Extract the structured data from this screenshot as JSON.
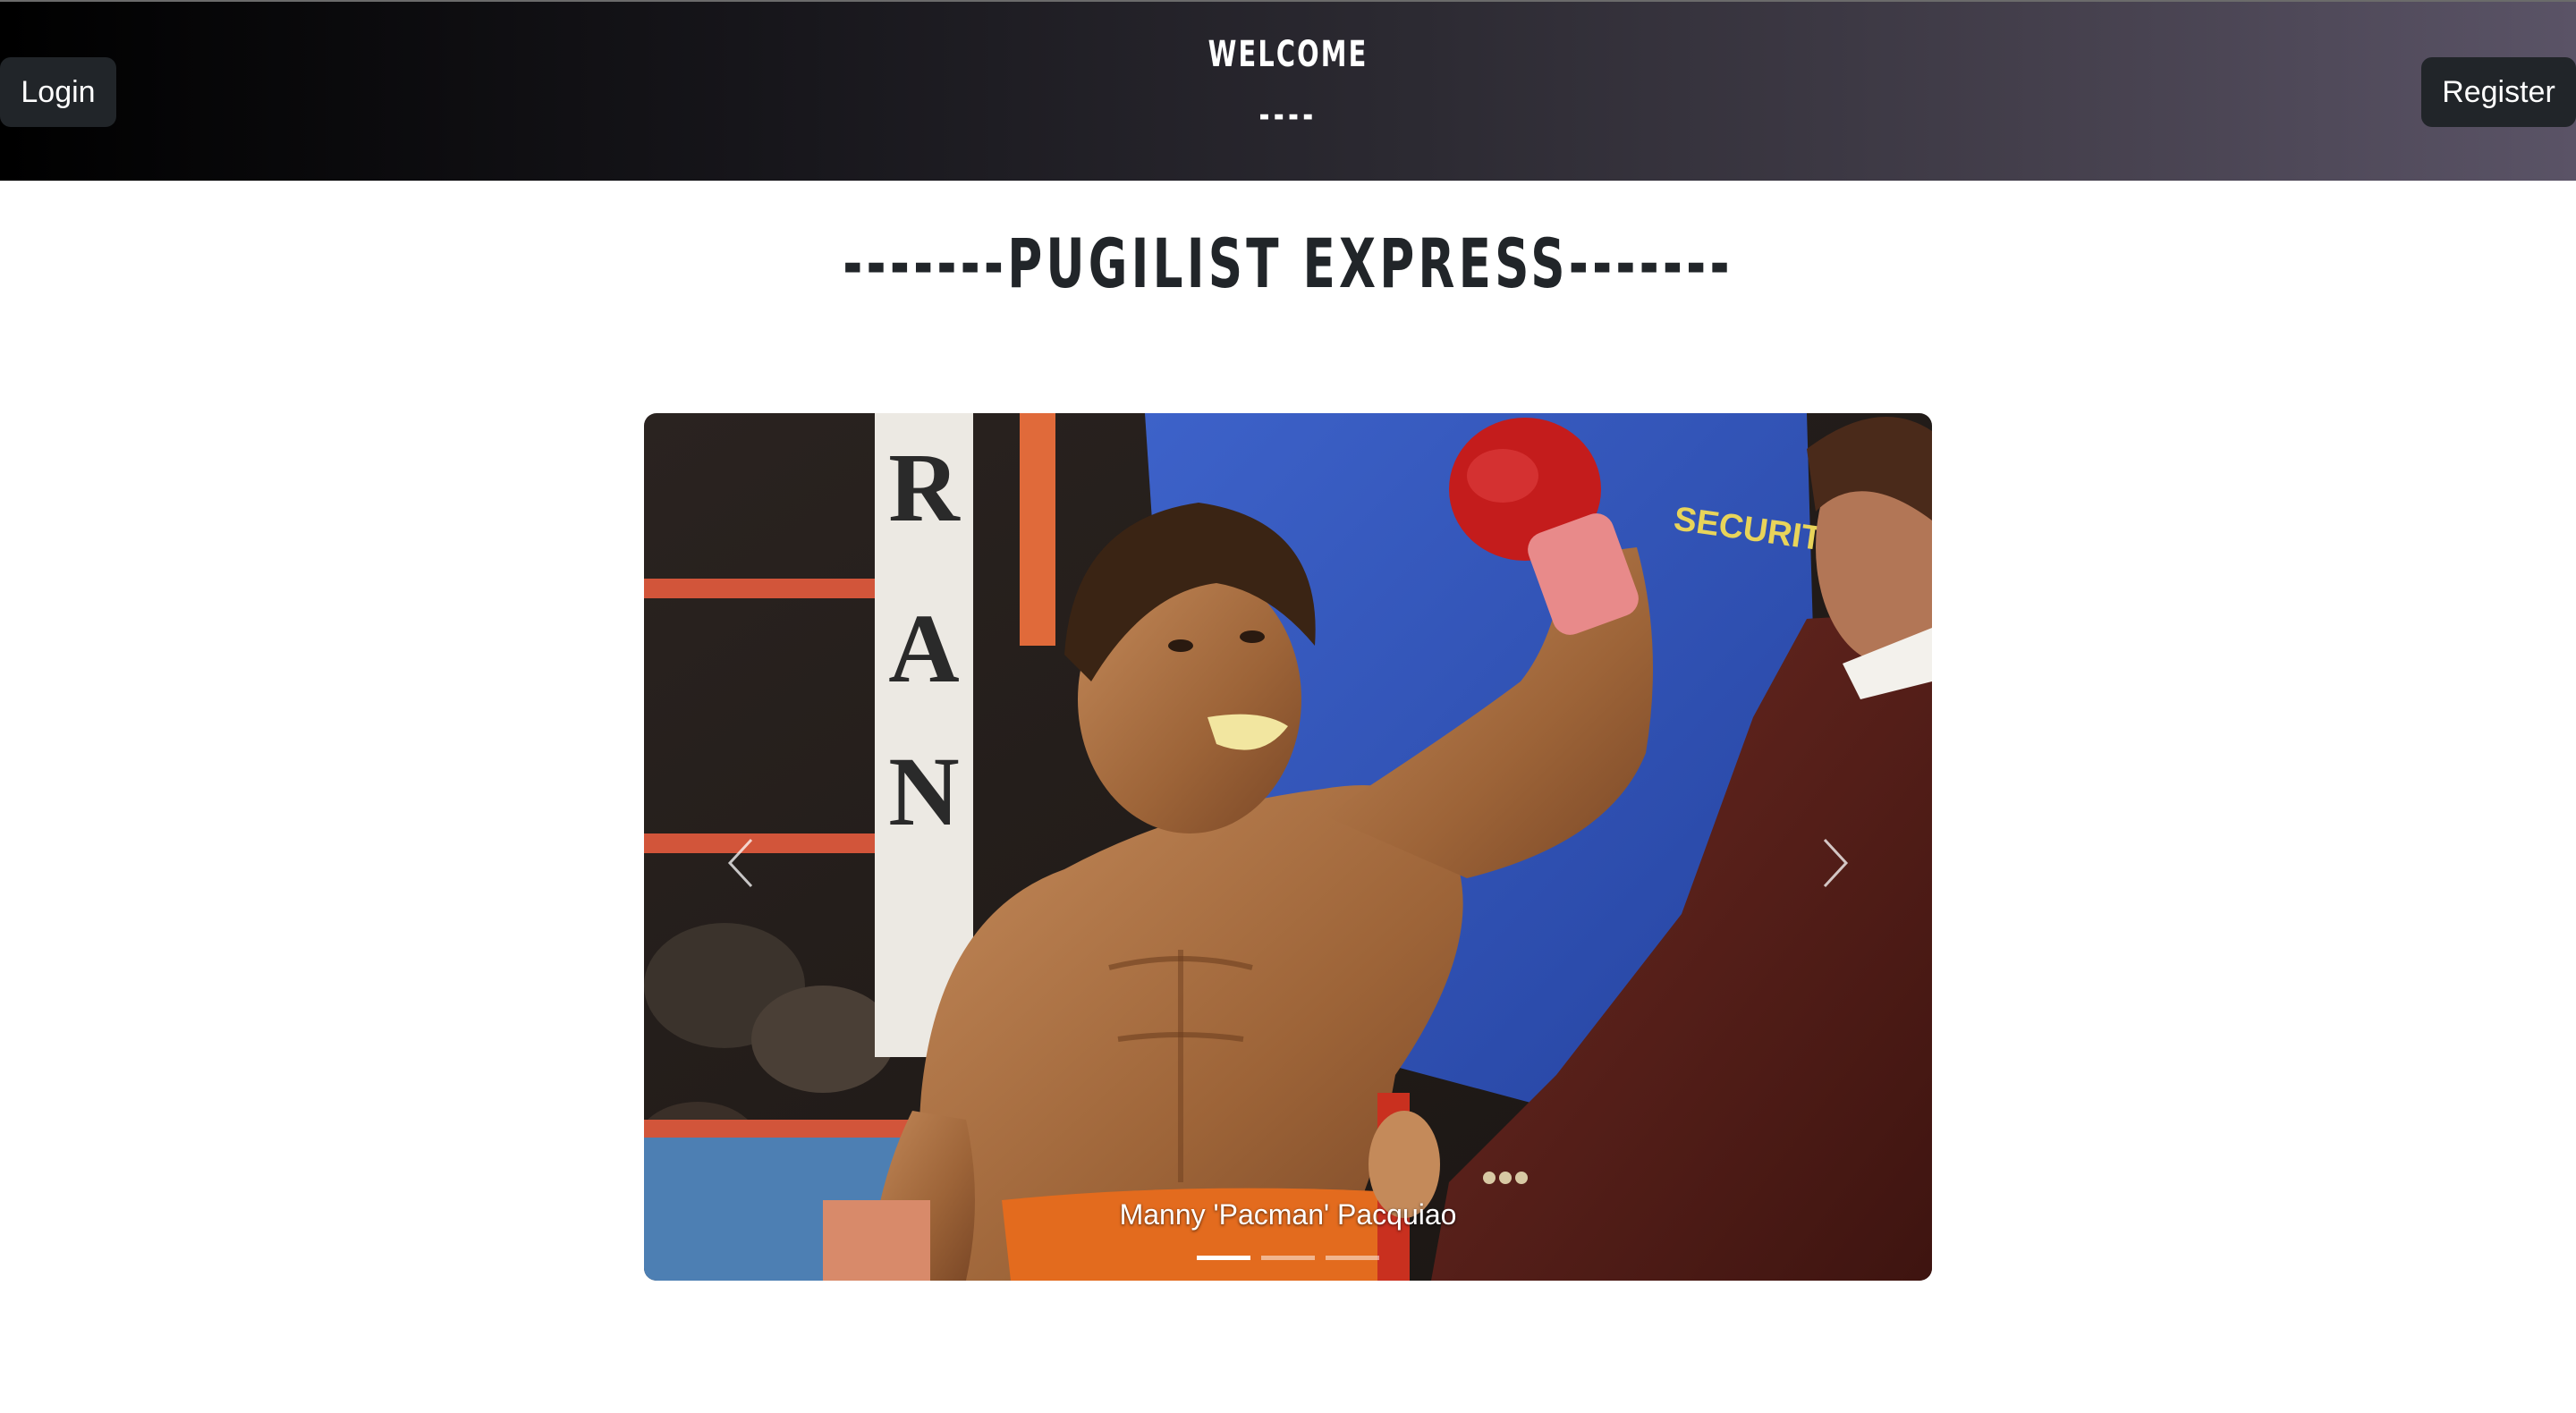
{
  "header": {
    "login_label": "Login",
    "register_label": "Register",
    "welcome": "WELCOME",
    "welcome_sub": "----"
  },
  "title": "-------PUGILIST EXPRESS-------",
  "carousel": {
    "caption": "Manny 'Pacman' Pacquiao",
    "slide_count": 3,
    "active_index": 0,
    "prev_icon": "chevron-left-icon",
    "next_icon": "chevron-right-icon",
    "photo_text": {
      "corner_banner": "RAN",
      "security_patch": "SECURITY"
    }
  },
  "colors": {
    "header_gradient_start": "#000000",
    "header_gradient_end": "#5a5366",
    "button_bg": "#212529",
    "title_color": "#212529"
  }
}
